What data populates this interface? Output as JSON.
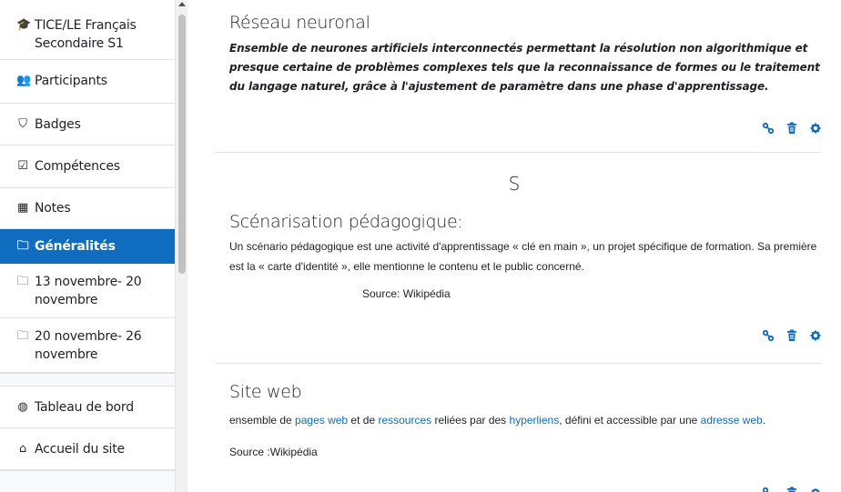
{
  "sidebar": {
    "course": {
      "icon": "graduation-cap-icon",
      "label": "TICE/LE Français Secondaire S1"
    },
    "items": [
      {
        "name": "participants",
        "icon": "users-icon",
        "label": "Participants"
      },
      {
        "name": "badges",
        "icon": "shield-icon",
        "label": "Badges"
      },
      {
        "name": "competences",
        "icon": "checkbox-icon",
        "label": "Compétences"
      },
      {
        "name": "notes",
        "icon": "table-icon",
        "label": "Notes"
      },
      {
        "name": "generalites",
        "icon": "folder-icon",
        "label": "Généralités",
        "active": true
      },
      {
        "name": "week-1",
        "icon": "folder-icon",
        "label": "13 novembre- 20 novembre"
      },
      {
        "name": "week-2",
        "icon": "folder-icon",
        "label": "20 novembre- 26 novembre"
      }
    ],
    "bottom": [
      {
        "name": "dashboard",
        "icon": "dashboard-icon",
        "label": "Tableau de bord"
      },
      {
        "name": "home",
        "icon": "home-icon",
        "label": "Accueil du site"
      }
    ]
  },
  "entries": {
    "reseau": {
      "concept": "Réseau neuronal",
      "definition": "Ensemble de neurones artificiels interconnectés permettant la résolution non algorithmique et presque certaine de problèmes complexes tels que la reconnaissance de formes ou le traitement du langage naturel, grâce à l'ajustement de paramètre dans une phase d'apprentissage."
    },
    "letter": "S",
    "scenarisation": {
      "concept": "Scénarisation pédagogique:",
      "definition": "Un scénario pédagogique est une activité d'apprentissage « clé en main », un projet spécifique de formation. Sa première est la « carte d'identité », elle mentionne le contenu et le public concerné.",
      "source": "Source: Wikipédia"
    },
    "siteweb": {
      "concept": "Site web",
      "def_part1": "ensemble de ",
      "link1": "pages web",
      "def_part2": " et de ",
      "link2": "ressources",
      "def_part3": " reliées par des ",
      "link3": "hyperliens",
      "def_part4": ", défini et accessible par une ",
      "link4": "adresse web",
      "def_part5": ".",
      "source": "Source :Wikipédia"
    }
  },
  "action_icons": [
    "link-icon",
    "trash-icon",
    "gear-icon"
  ],
  "colors": {
    "accent": "#0f6cbf",
    "link": "#0f6cbf",
    "icon": "#0f6cbf"
  }
}
